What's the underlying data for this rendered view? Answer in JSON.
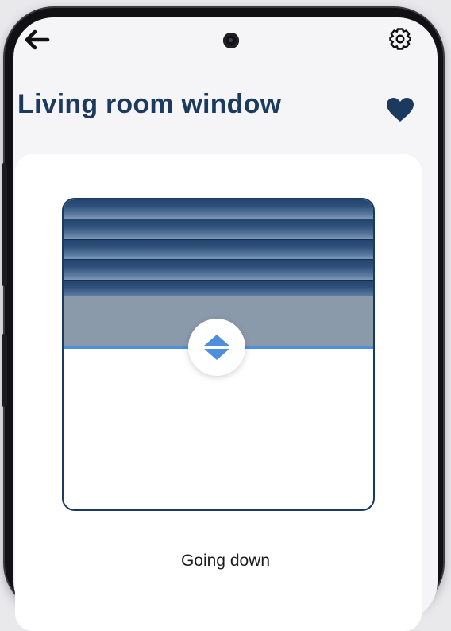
{
  "header": {
    "title": "Living room window",
    "back_icon": "arrow-left-icon",
    "settings_icon": "gear-icon",
    "favorite_icon": "heart-icon"
  },
  "blind": {
    "status": "Going down",
    "handle_icon": "up-down-arrows-icon",
    "colors": {
      "slat": "#2e507a",
      "shade": "#8b9aab",
      "indicator": "#4d8fdc",
      "frame": "#1c3a5e"
    }
  },
  "colors": {
    "title": "#1c3a5e",
    "accent": "#4d8fdc"
  }
}
